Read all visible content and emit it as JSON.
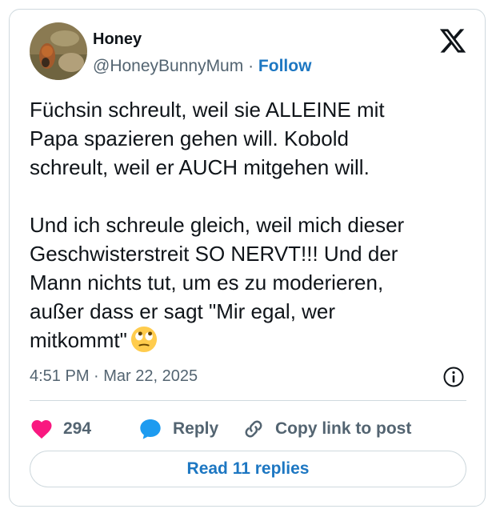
{
  "tweet": {
    "display_name": "Honey",
    "handle": "@HoneyBunnyMum",
    "separator": "·",
    "follow_label": "Follow",
    "text": "Füchsin schreult, weil sie ALLEINE mit\nPapa spazieren gehen will. Kobold\nschreult, weil er AUCH mitgehen will.\n\nUnd ich schreule gleich, weil mich dieser\nGeschwisterstreit SO NERVT!!! Und der\nMann nichts tut, um es zu moderieren,\naußer dass er sagt \"Mir egal, wer\nmitkommt\"",
    "emoji": "rolling-eyes-emoji",
    "timestamp": "4:51 PM · Mar 22, 2025"
  },
  "actions": {
    "likes": "294",
    "reply_label": "Reply",
    "copy_label": "Copy link to post"
  },
  "read_replies_label": "Read 11 replies",
  "icons": [
    "x-logo-icon",
    "info-icon",
    "heart-icon",
    "reply-icon",
    "link-icon"
  ],
  "colors": {
    "heart": "#f91880",
    "reply": "#1d9bf0",
    "link": "#1d77c2",
    "secondary_text": "#536471",
    "border": "#cfd9de"
  }
}
